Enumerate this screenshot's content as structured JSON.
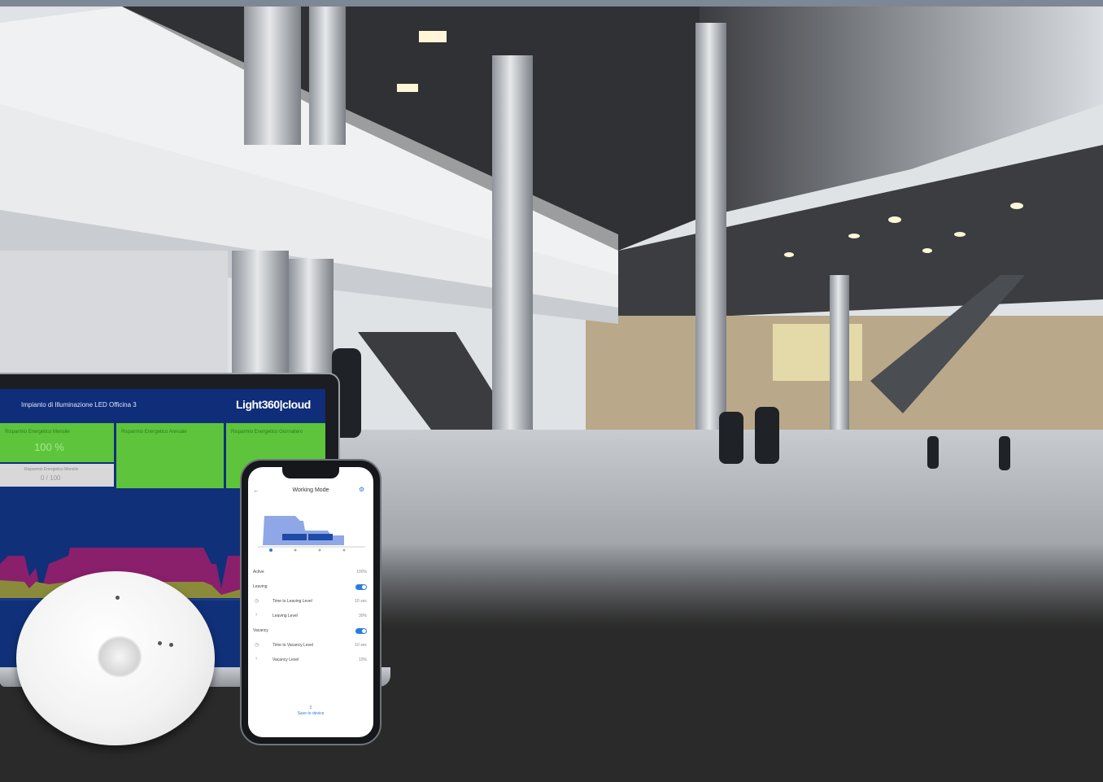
{
  "scene": {
    "description_colors": {
      "ceiling": "#2e2f33",
      "floor": "#9aa0a6",
      "dark_band": "#2a2a2a"
    }
  },
  "laptop": {
    "window_title": "Impianto di Illuminazione LED Officina 3",
    "brand": "Light360|cloud",
    "accent": "#5ec43c",
    "tiles": [
      {
        "title": "Risparmio Energetico Mensile",
        "value": "100 %"
      },
      {
        "title": "Risparmio Energetico Annuale",
        "value": ""
      },
      {
        "title": "Risparmio Energetico Giornaliero",
        "value": ""
      }
    ],
    "gray_tile": {
      "title": "Risparmio Energetico Mensile",
      "value": "0 / 100"
    }
  },
  "phone": {
    "header": "Working Mode",
    "rows": [
      {
        "label": "Active",
        "value": "100%"
      },
      {
        "label": "Leaving",
        "toggle": true
      },
      {
        "label": "Time to Leaving Level",
        "value": "10 sec",
        "icon": "clock-icon"
      },
      {
        "label": "Leaving Level",
        "value": "30%",
        "icon": "bulb-icon"
      },
      {
        "label": "Vacancy",
        "toggle": true
      },
      {
        "label": "Time to Vacancy Level",
        "value": "10 sec",
        "icon": "clock-icon"
      },
      {
        "label": "Vacancy Level",
        "value": "10%",
        "icon": "bulb-icon"
      }
    ],
    "footer": "Save to device",
    "accent": "#2a7be4"
  }
}
